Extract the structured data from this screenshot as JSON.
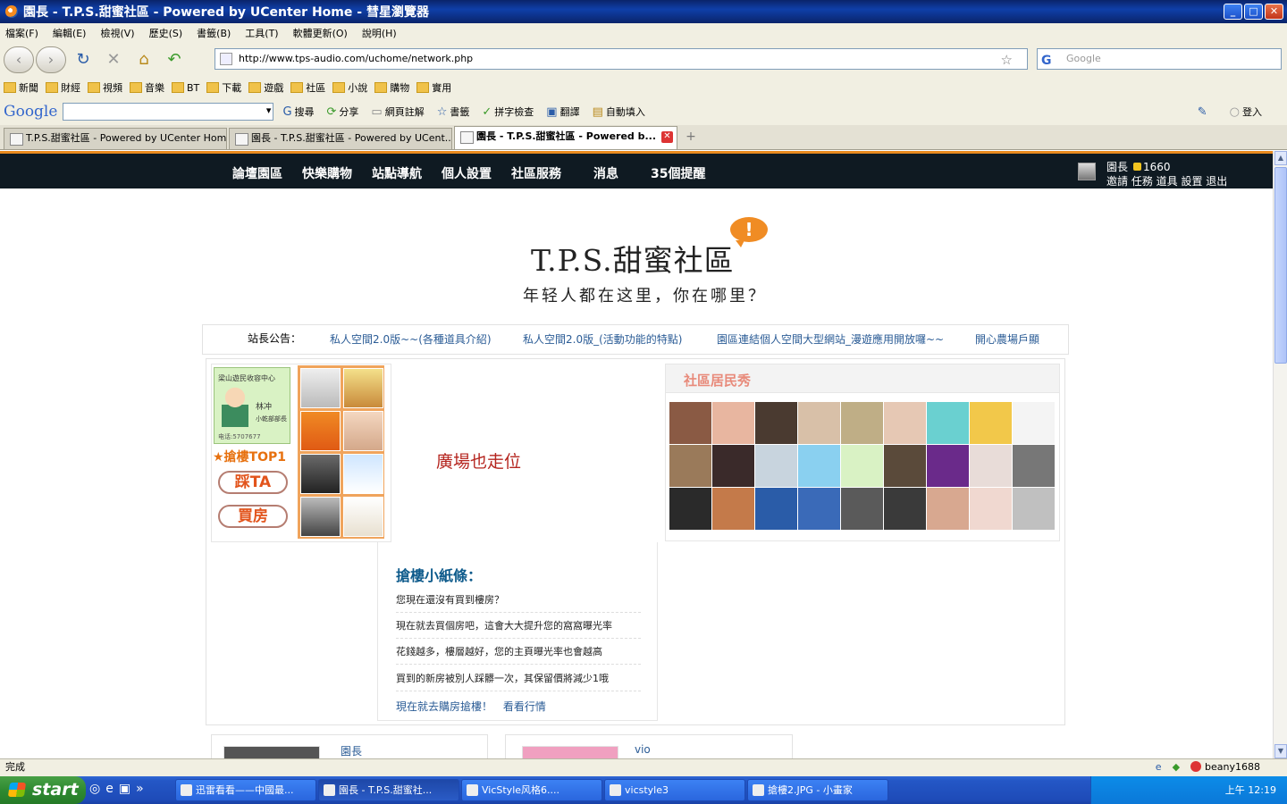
{
  "window": {
    "title": "園長 - T.P.S.甜蜜社區 - Powered by UCenter Home - 彗星瀏覽器",
    "buttons": [
      "_",
      "□",
      "✕"
    ]
  },
  "menu": [
    "檔案(F)",
    "編輯(E)",
    "檢視(V)",
    "歷史(S)",
    "書籤(B)",
    "工具(T)",
    "軟體更新(O)",
    "說明(H)"
  ],
  "nav": {
    "url": "http://www.tps-audio.com/uchome/network.php",
    "search_placeholder": "Google"
  },
  "bookmarks": [
    "新聞",
    "財經",
    "視頻",
    "音樂",
    "BT",
    "下載",
    "遊戲",
    "社區",
    "小說",
    "購物",
    "實用"
  ],
  "google_toolbar": {
    "logo": "Google",
    "items": [
      "搜尋",
      "分享",
      "網頁註解",
      "書籤",
      "拼字檢查",
      "翻譯",
      "自動填入"
    ],
    "login": "登入"
  },
  "tabs": [
    {
      "label": "T.P.S.甜蜜社區 - Powered by UCenter Home",
      "active": false
    },
    {
      "label": "園長 - T.P.S.甜蜜社區 - Powered by UCent...",
      "active": false
    },
    {
      "label": "園長 - T.P.S.甜蜜社區 - Powered b...",
      "active": true
    }
  ],
  "site": {
    "nav": [
      "論壇園區",
      "快樂購物",
      "站點導航",
      "個人設置",
      "社區服務",
      "消息",
      "35個提醒"
    ],
    "user": {
      "name": "園長",
      "coins": "1660",
      "links": "邀請 任務 道具 設置 退出"
    },
    "logo_text": "T.P.S.甜蜜社區",
    "logo_bubble": "!",
    "slogan": "年轻人都在这里，你在哪里？",
    "announce_label": "站長公告：",
    "announcements": [
      "私人空間2.0版~~(各種道具介紹)",
      "私人空間2.0版_(活動功能的特點)",
      "園區連結個人空間大型網站_漫遊應用開放囉~~",
      "開心農場戶顯"
    ],
    "card": {
      "top_text": "梁山遊民收容中心",
      "name": "林冲",
      "sub": "小乾部部長",
      "phone": "电话:5707677"
    },
    "top1": "★搶樓TOP1",
    "btn_step": "踩TA",
    "btn_buy": "買房",
    "plaza": "廣場也走位",
    "residents_title": "社區居民秀",
    "notes": {
      "title": "搶樓小紙條：",
      "lines": [
        "您現在還沒有買到樓房？",
        "現在就去買個房吧，這會大大提升您的窩窩曝光率",
        "花錢越多，樓層越好，您的主頁曝光率也會越高",
        "買到的新房被別人踩髒一次，其保留價將減少1哦"
      ],
      "link1": "現在就去購房搶樓！",
      "link2": "看看行情"
    },
    "bottom_names": [
      "園長",
      "vio"
    ]
  },
  "status": {
    "text": "完成",
    "user": "beany1688"
  },
  "taskbar": {
    "start": "start",
    "tasks": [
      {
        "label": "迅雷看看——中國最...",
        "active": false
      },
      {
        "label": "園長 - T.P.S.甜蜜社...",
        "active": true
      },
      {
        "label": "VicStyle风格6....",
        "active": false
      },
      {
        "label": "vicstyle3",
        "active": false
      },
      {
        "label": "搶樓2.JPG - 小畫家",
        "active": false
      }
    ],
    "clock": "上午 12:19"
  },
  "colors": {
    "site_header": "#0f1a22",
    "accent_orange": "#e98a1e",
    "link_blue": "#2b5c96",
    "plaza_red": "#b5251f"
  }
}
